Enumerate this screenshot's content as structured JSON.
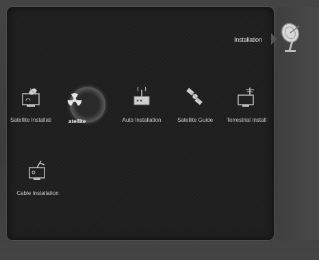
{
  "header": {
    "title": "Installation",
    "icon": "satellite-dish-icon"
  },
  "menu": {
    "items": [
      {
        "label": "Satellite Installati",
        "icon": "satellite-screen-icon",
        "selected": false
      },
      {
        "label": "atellite",
        "icon": "radiation-icon",
        "selected": true
      },
      {
        "label": "Auto Installation",
        "icon": "antenna-box-icon",
        "selected": false
      },
      {
        "label": "Satellite Guide",
        "icon": "satellite-icon",
        "selected": false
      },
      {
        "label": "Terrestrial Install",
        "icon": "terrestrial-screen-icon",
        "selected": false
      },
      {
        "label": "Cable Installation",
        "icon": "cable-screen-icon",
        "selected": false
      }
    ]
  },
  "colors": {
    "panel": "#1f1f1f",
    "text": "#cfcfcf",
    "selected_text": "#ffffff"
  }
}
